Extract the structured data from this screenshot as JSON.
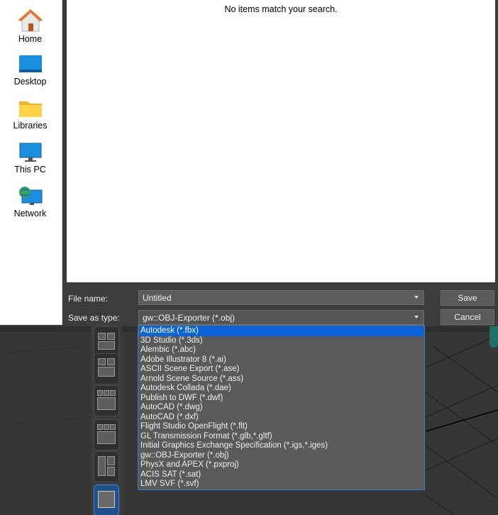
{
  "places": [
    {
      "label": "Home",
      "icon": "home-icon"
    },
    {
      "label": "Desktop",
      "icon": "desktop-icon"
    },
    {
      "label": "Libraries",
      "icon": "folder-icon"
    },
    {
      "label": "This PC",
      "icon": "monitor-icon"
    },
    {
      "label": "Network",
      "icon": "network-icon"
    }
  ],
  "filelist": {
    "empty_message": "No items match your search."
  },
  "form": {
    "file_name_label": "File name:",
    "file_name_value": "Untitled",
    "save_as_type_label": "Save as type:",
    "save_as_type_value": "gw::OBJ-Exporter (*.obj)"
  },
  "buttons": {
    "save": "Save",
    "cancel": "Cancel"
  },
  "file_types": [
    "Autodesk (*.fbx)",
    "3D Studio (*.3ds)",
    "Alembic (*.abc)",
    "Adobe Illustrator 8 (*.ai)",
    "ASCII Scene Export (*.ase)",
    "Arnold Scene Source (*.ass)",
    "Autodesk Collada (*.dae)",
    "Publish to DWF (*.dwf)",
    "AutoCAD (*.dwg)",
    "AutoCAD (*.dxf)",
    "Flight Studio OpenFlight (*.flt)",
    "GL Transmission Format (*.glb,*.gltf)",
    "Initial Graphics Exchange Specification (*.igs,*.iges)",
    "gw::OBJ-Exporter (*.obj)",
    "PhysX and APEX (*.pxproj)",
    "ACIS SAT (*.sat)",
    "LMV SVF (*.svf)"
  ],
  "selected_file_type_index": 0,
  "colors": {
    "accent": "#0a64d8",
    "dialog_bg": "#3c3c3c",
    "dropdown_bg": "#5a5a5a"
  }
}
